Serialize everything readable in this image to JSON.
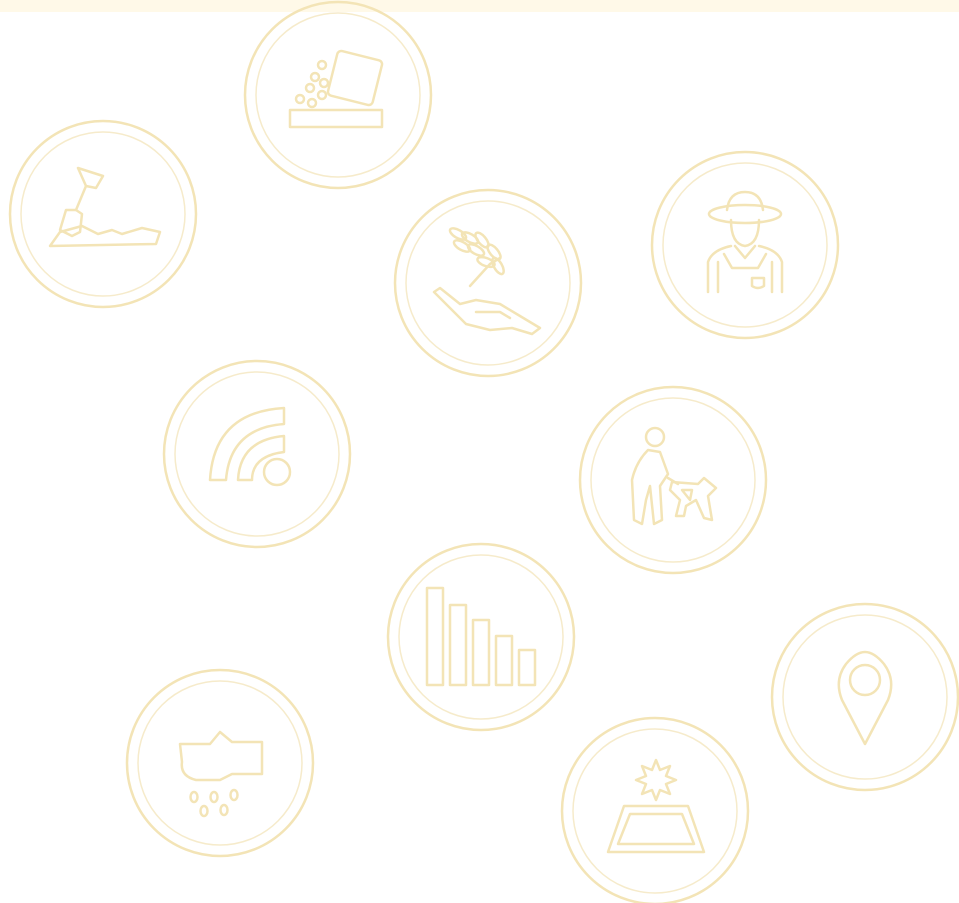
{
  "palette": {
    "background": "#ffffff",
    "band": "#fff9e8",
    "line": "#f3e4b6",
    "line_light": "#f6ebcb"
  },
  "icons": [
    {
      "name": "soil-digging-shovel-icon"
    },
    {
      "name": "pouring-seeds-icon"
    },
    {
      "name": "hand-holding-wheat-icon"
    },
    {
      "name": "farmer-icon"
    },
    {
      "name": "wireless-signal-icon"
    },
    {
      "name": "person-walking-dog-icon"
    },
    {
      "name": "descending-bar-chart-icon"
    },
    {
      "name": "location-pin-icon"
    },
    {
      "name": "soil-clump-with-seeds-icon"
    },
    {
      "name": "field-with-sun-icon"
    }
  ]
}
